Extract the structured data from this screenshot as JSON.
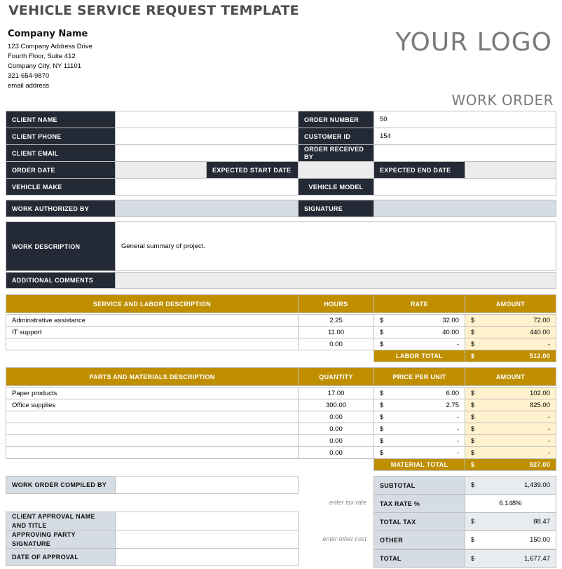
{
  "header": {
    "title": "VEHICLE SERVICE REQUEST TEMPLATE",
    "company_name": "Company Name",
    "address_lines": [
      "123 Company Address Drive",
      "Fourth Floor, Suite 412",
      "Company City, NY  11101",
      "321-654-9870",
      "email address"
    ],
    "logo": "YOUR LOGO",
    "doc_type": "WORK ORDER"
  },
  "client": {
    "client_name_label": "CLIENT NAME",
    "client_name": "",
    "client_phone_label": "CLIENT PHONE",
    "client_phone": "",
    "client_email_label": "CLIENT EMAIL",
    "client_email": "",
    "order_number_label": "ORDER NUMBER",
    "order_number": "50",
    "customer_id_label": "CUSTOMER ID",
    "customer_id": "154",
    "order_received_by_label": "ORDER RECEIVED BY",
    "order_received_by": "",
    "order_date_label": "ORDER DATE",
    "order_date": "",
    "expected_start_label": "EXPECTED START DATE",
    "expected_start": "",
    "expected_end_label": "EXPECTED END DATE",
    "expected_end": "",
    "vehicle_make_label": "VEHICLE MAKE",
    "vehicle_make": "",
    "vehicle_model_label": "VEHICLE MODEL",
    "vehicle_model": ""
  },
  "authorization": {
    "authorized_by_label": "WORK AUTHORIZED BY",
    "authorized_by": "",
    "signature_label": "SIGNATURE",
    "signature": ""
  },
  "description": {
    "work_description_label": "WORK DESCRIPTION",
    "work_description": "General summary of project.",
    "additional_comments_label": "ADDITIONAL COMMENTS",
    "additional_comments": ""
  },
  "labor": {
    "headers": [
      "SERVICE AND LABOR DESCRIPTION",
      "HOURS",
      "RATE",
      "AMOUNT"
    ],
    "rows": [
      {
        "desc": "Adminstrative assistance",
        "hours": "2.25",
        "rate": "32.00",
        "amount": "72.00"
      },
      {
        "desc": "IT support",
        "hours": "11.00",
        "rate": "40.00",
        "amount": "440.00"
      },
      {
        "desc": "",
        "hours": "0.00",
        "rate": "-",
        "amount": "-"
      }
    ],
    "total_label": "LABOR TOTAL",
    "total": "512.00",
    "currency": "$"
  },
  "materials": {
    "headers": [
      "PARTS AND MATERIALS DESCRIPTION",
      "QUANTITY",
      "PRICE PER UNIT",
      "AMOUNT"
    ],
    "rows": [
      {
        "desc": "Paper products",
        "qty": "17.00",
        "price": "6.00",
        "amount": "102.00"
      },
      {
        "desc": "Office supplies",
        "qty": "300.00",
        "price": "2.75",
        "amount": "825.00"
      },
      {
        "desc": "",
        "qty": "0.00",
        "price": "-",
        "amount": "-"
      },
      {
        "desc": "",
        "qty": "0.00",
        "price": "-",
        "amount": "-"
      },
      {
        "desc": "",
        "qty": "0.00",
        "price": "-",
        "amount": "-"
      },
      {
        "desc": "",
        "qty": "0.00",
        "price": "-",
        "amount": "-"
      }
    ],
    "total_label": "MATERIAL TOTAL",
    "total": "927.00",
    "currency": "$"
  },
  "approval": {
    "compiled_by_label": "WORK ORDER COMPILED BY",
    "compiled_by": "",
    "client_approval_label": "CLIENT APPROVAL NAME AND TITLE",
    "client_approval": "",
    "approving_signature_label": "APPROVING PARTY SIGNATURE",
    "approving_signature": "",
    "date_of_approval_label": "DATE OF APPROVAL",
    "date_of_approval": ""
  },
  "summary": {
    "hint_tax": "enter tax rate",
    "hint_other": "enter other cost",
    "currency": "$",
    "subtotal_label": "SUBTOTAL",
    "subtotal": "1,439.00",
    "tax_rate_label": "TAX RATE %",
    "tax_rate": "6.148%",
    "total_tax_label": "TOTAL TAX",
    "total_tax": "88.47",
    "other_label": "OTHER",
    "other": "150.00",
    "total_label": "TOTAL",
    "total": "1,677.47"
  }
}
